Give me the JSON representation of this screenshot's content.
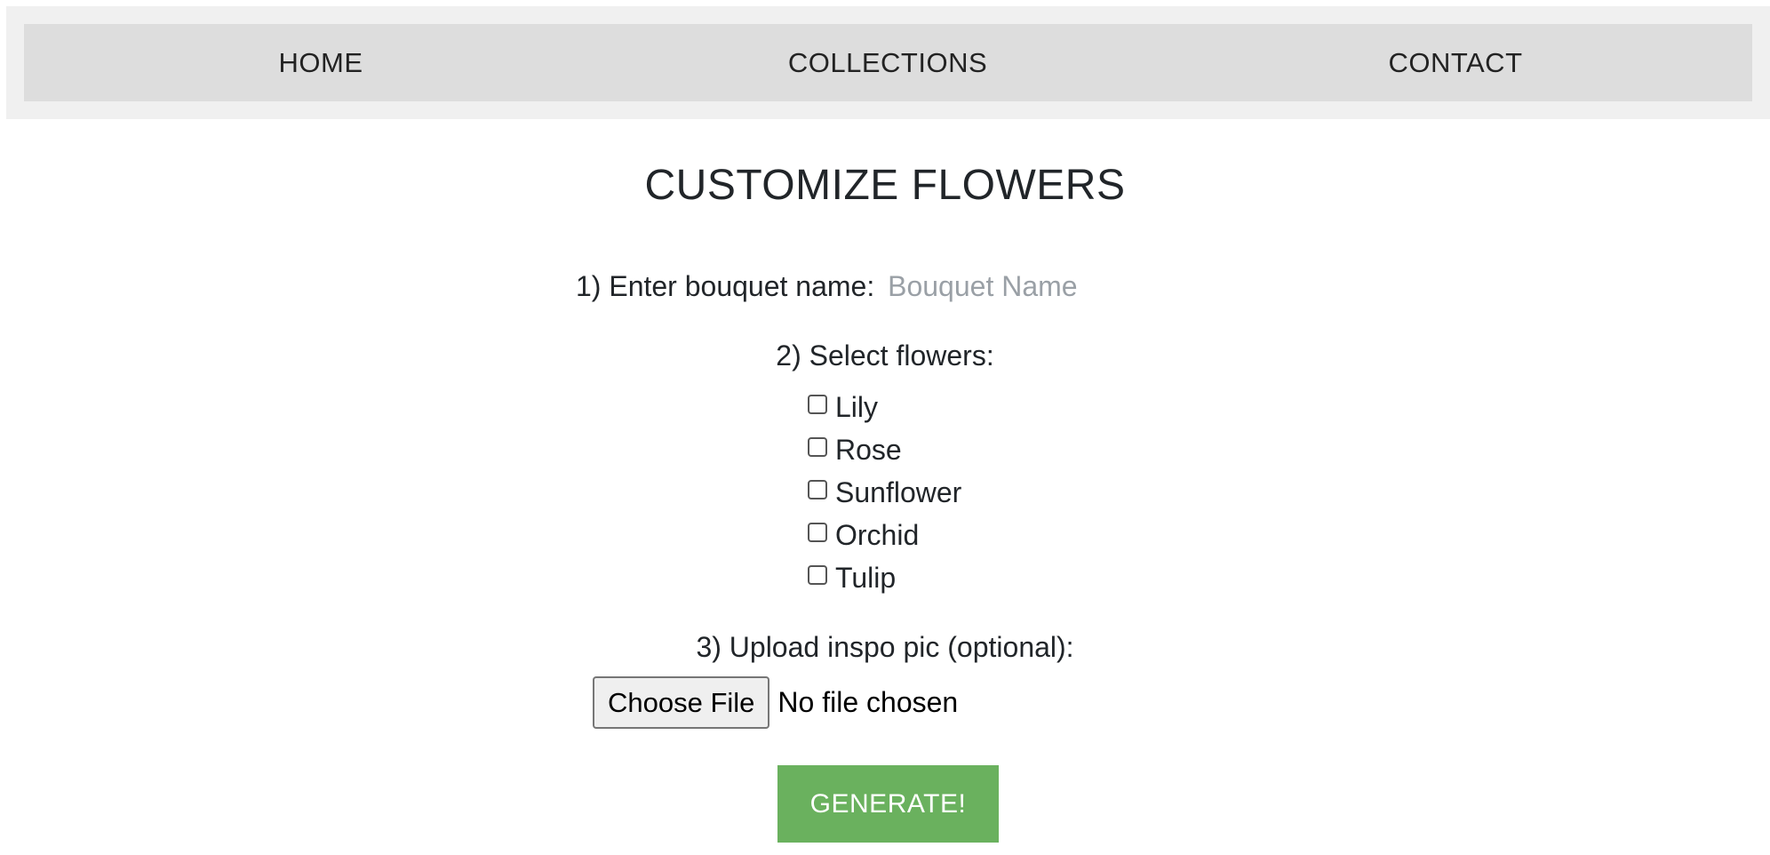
{
  "nav": {
    "items": [
      {
        "label": "HOME"
      },
      {
        "label": "COLLECTIONS"
      },
      {
        "label": "CONTACT"
      }
    ]
  },
  "main": {
    "title": "CUSTOMIZE FLOWERS",
    "bouquet_name": {
      "label": "1) Enter bouquet name:",
      "placeholder": "Bouquet Name",
      "value": ""
    },
    "flowers": {
      "label": "2) Select flowers:",
      "options": [
        {
          "label": "Lily",
          "checked": false
        },
        {
          "label": "Rose",
          "checked": false
        },
        {
          "label": "Sunflower",
          "checked": false
        },
        {
          "label": "Orchid",
          "checked": false
        },
        {
          "label": "Tulip",
          "checked": false
        }
      ]
    },
    "upload": {
      "label": "3) Upload inspo pic (optional):",
      "button_label": "Choose File",
      "status": "No file chosen"
    },
    "generate_label": "GENERATE!"
  },
  "colors": {
    "nav_outer_bg": "#f0f0f0",
    "nav_inner_bg": "#dddddd",
    "generate_bg": "#6ab15e",
    "placeholder": "#9aa0a6"
  }
}
